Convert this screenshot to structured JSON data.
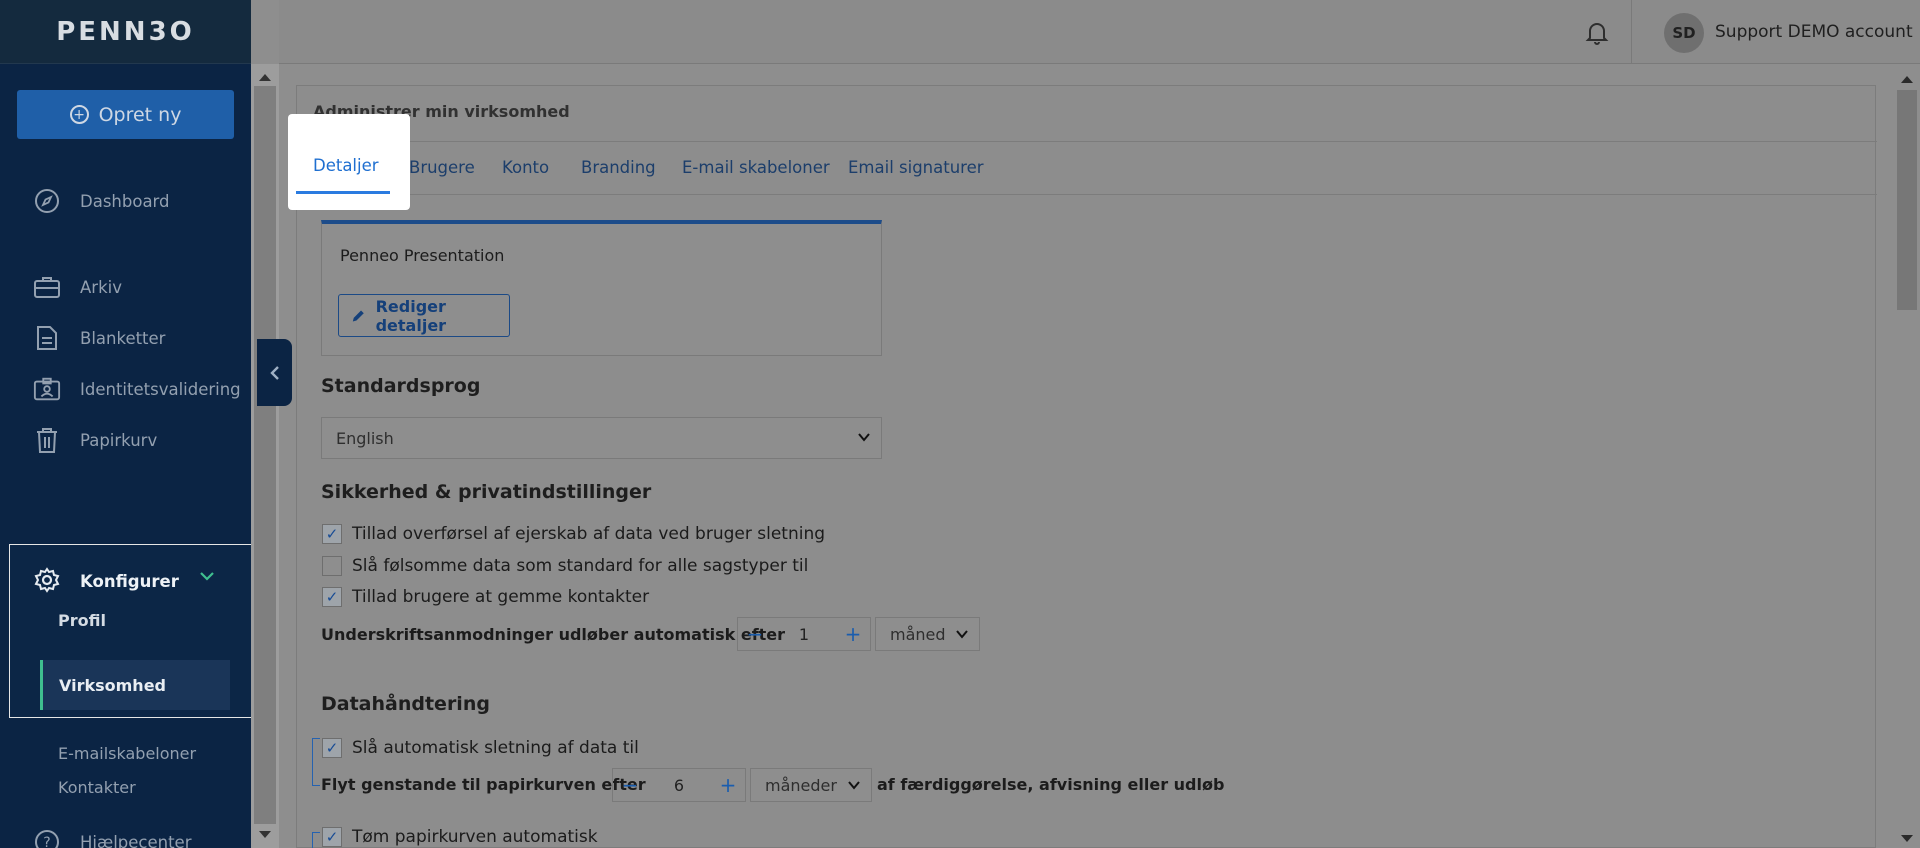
{
  "app": {
    "logo": "PENN3O"
  },
  "sidebar": {
    "create_label": "Opret ny",
    "items": [
      {
        "label": "Dashboard",
        "icon": "compass-icon"
      },
      {
        "label": "Arkiv",
        "icon": "briefcase-icon"
      },
      {
        "label": "Blanketter",
        "icon": "document-icon"
      },
      {
        "label": "Identitetsvalidering",
        "icon": "id-badge-icon"
      },
      {
        "label": "Papirkurv",
        "icon": "trash-icon"
      }
    ],
    "config_label": "Konfigurer",
    "sub_items": [
      {
        "label": "Profil"
      },
      {
        "label": "Virksomhed"
      },
      {
        "label": "E-mailskabeloner"
      },
      {
        "label": "Kontakter"
      }
    ],
    "help_label": "Hjælpecenter"
  },
  "topbar": {
    "avatar_initials": "SD",
    "account_name": "Support DEMO account"
  },
  "main": {
    "panel_title": "Administrer min virksomhed",
    "tabs": [
      {
        "label": "Detaljer"
      },
      {
        "label": "Brugere"
      },
      {
        "label": "Konto"
      },
      {
        "label": "Branding"
      },
      {
        "label": "E-mail skabeloner"
      },
      {
        "label": "Email signaturer"
      }
    ],
    "company_name": "Penneo Presentation",
    "edit_button": "Rediger detaljer",
    "language_heading": "Standardsprog",
    "language_value": "English",
    "security_heading": "Sikkerhed & privatindstillinger",
    "security_options": [
      {
        "label": "Tillad overførsel af ejerskab af data ved bruger sletning",
        "checked": true
      },
      {
        "label": "Slå følsomme data som standard for alle sagstyper til",
        "checked": false
      },
      {
        "label": "Tillad brugere at gemme kontakter",
        "checked": true
      }
    ],
    "expiry_label": "Underskriftsanmodninger udløber automatisk efter",
    "expiry_value": "1",
    "expiry_unit": "måned",
    "data_heading": "Datahåndtering",
    "auto_delete_label": "Slå automatisk sletning af data til",
    "auto_delete_checked": true,
    "move_label": "Flyt genstande til papirkurven efter",
    "move_value": "6",
    "move_unit": "måneder",
    "move_suffix": "af færdiggørelse, afvisning eller udløb",
    "empty_trash_label": "Tøm papirkurven automatisk",
    "empty_trash_checked": true
  },
  "colors": {
    "sidebar_bg": "#0b2444",
    "accent": "#1f6fd0",
    "active_marker": "#3fbf8f"
  }
}
